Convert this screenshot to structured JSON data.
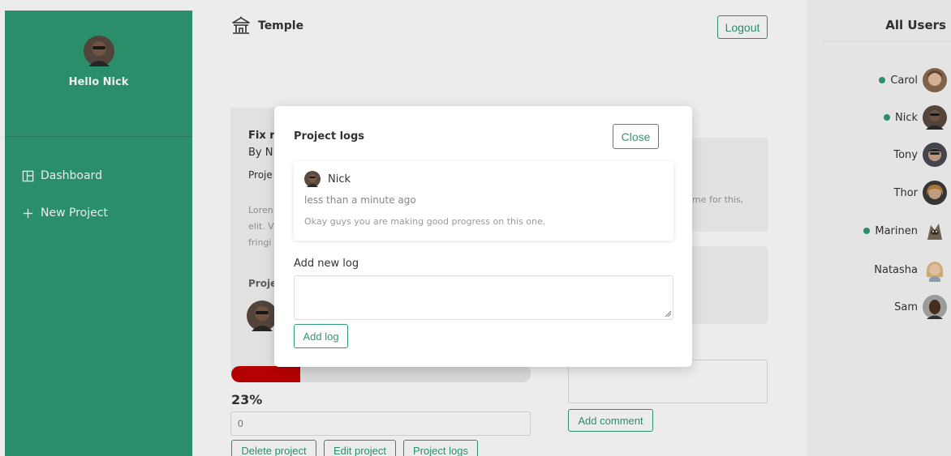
{
  "app": {
    "title": "Temple"
  },
  "colors": {
    "accent": "#2e9a73",
    "progress": "#c40000",
    "online": "#2e9a73"
  },
  "sidebar": {
    "greeting": "Hello Nick",
    "items": [
      {
        "label": "Dashboard",
        "icon": "dashboard-icon"
      },
      {
        "label": "New Project",
        "icon": "plus-icon"
      }
    ]
  },
  "header": {
    "logout_label": "Logout"
  },
  "project": {
    "title_partial": "Fix r",
    "by_partial": "By N",
    "project_label_partial": "Proje",
    "desc_line1": "Loren",
    "desc_line2": "elit. V",
    "desc_line3": "fringi",
    "members_label_partial": "Proje",
    "progress_value": 0.23,
    "progress_text": "23%",
    "progress_input_value": "0",
    "buttons": {
      "delete": "Delete project",
      "edit": "Edit project",
      "logs": "Project logs"
    }
  },
  "comments": {
    "visible_text": "me for this,",
    "add_comment_label": "Add comment"
  },
  "users_panel": {
    "title": "All Users",
    "users": [
      {
        "name": "Carol",
        "online": true
      },
      {
        "name": "Nick",
        "online": true
      },
      {
        "name": "Tony",
        "online": false
      },
      {
        "name": "Thor",
        "online": false
      },
      {
        "name": "Marinen",
        "online": true
      },
      {
        "name": "Natasha",
        "online": false
      },
      {
        "name": "Sam",
        "online": false
      }
    ]
  },
  "modal": {
    "title": "Project logs",
    "close_label": "Close",
    "log": {
      "author": "Nick",
      "time": "less than a minute ago",
      "message": "Okay guys you are making good progress on this one."
    },
    "add_new_label": "Add new log",
    "textarea_value": "",
    "add_button_label": "Add log"
  }
}
